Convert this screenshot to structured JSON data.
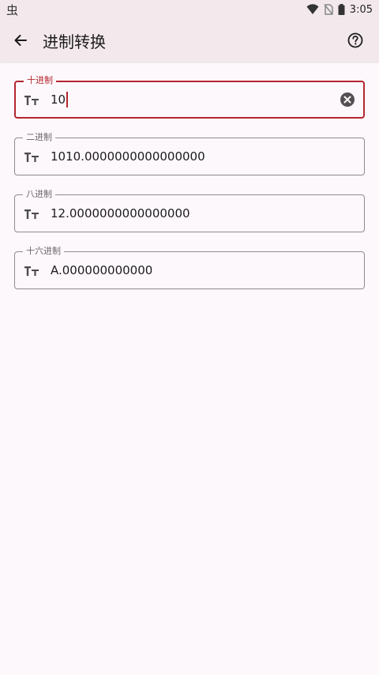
{
  "status_bar": {
    "app_icon_glyph": "虫",
    "time": "3:05",
    "icons": [
      "wifi-icon",
      "no-sim-icon",
      "battery-icon"
    ]
  },
  "app_bar": {
    "title": "进制转换",
    "back_icon": "arrow-left-icon",
    "help_icon": "help-circle-icon"
  },
  "fields": [
    {
      "label": "十进制",
      "value": "10",
      "focused": true,
      "icon": "text-size-icon",
      "clear_icon": "clear-circle-icon"
    },
    {
      "label": "二进制",
      "value": "1010.0000000000000000",
      "focused": false,
      "icon": "text-size-icon"
    },
    {
      "label": "八进制",
      "value": "12.0000000000000000",
      "focused": false,
      "icon": "text-size-icon"
    },
    {
      "label": "十六进制",
      "value": "A.000000000000",
      "focused": false,
      "icon": "text-size-icon"
    }
  ],
  "colors": {
    "accent": "#b3262f",
    "app_bar_bg": "#f3e9ec",
    "page_bg": "#fdf8fb",
    "outline": "#8f8a8d"
  }
}
